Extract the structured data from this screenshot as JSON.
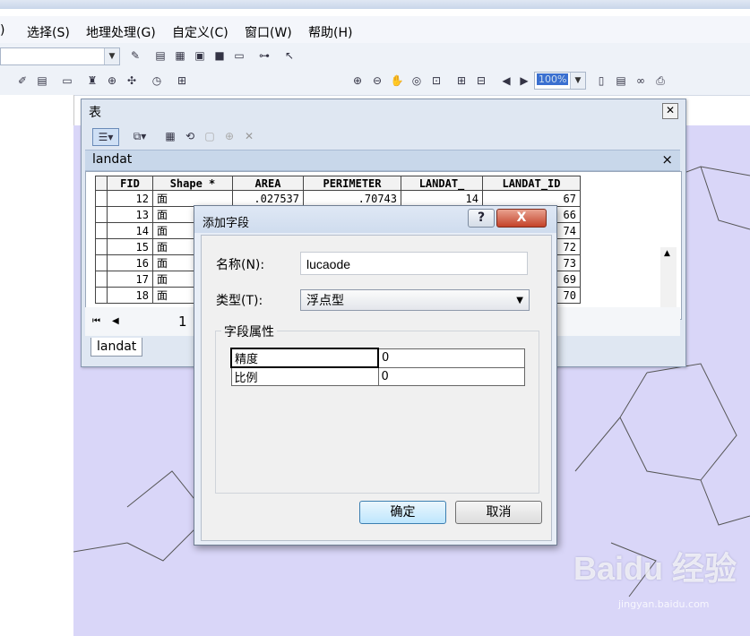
{
  "menu": [
    "选择(S)",
    "地理处理(G)",
    "自定义(C)",
    "窗口(W)",
    "帮助(H)"
  ],
  "toolbar": {
    "zoom_value": "100%"
  },
  "table_window": {
    "title": "表",
    "layer_name": "landat",
    "columns": [
      "FID",
      "Shape *",
      "AREA",
      "PERIMETER",
      "LANDAT_",
      "LANDAT_ID"
    ],
    "rows": [
      [
        "12",
        "面",
        ".027537",
        ".70743",
        "14",
        "67"
      ],
      [
        "13",
        "面",
        "",
        "",
        "",
        "66"
      ],
      [
        "14",
        "面",
        "",
        "",
        "",
        "74"
      ],
      [
        "15",
        "面",
        "",
        "",
        "",
        "72"
      ],
      [
        "16",
        "面",
        "",
        "",
        "",
        "73"
      ],
      [
        "17",
        "面",
        "",
        "",
        "",
        "69"
      ],
      [
        "18",
        "面",
        "",
        "",
        "",
        "70"
      ]
    ],
    "page_number": "1",
    "tab_label": "landat"
  },
  "dialog": {
    "title": "添加字段",
    "help_label": "?",
    "close_label": "X",
    "name_label": "名称(N):",
    "name_value": "lucaode",
    "type_label": "类型(T):",
    "type_value": "浮点型",
    "props_title": "字段属性",
    "props": [
      {
        "name": "精度",
        "value": "0"
      },
      {
        "name": "比例",
        "value": "0"
      }
    ],
    "ok_label": "确定",
    "cancel_label": "取消"
  },
  "watermark": {
    "text": "Baidu 经验",
    "sub": "jingyan.baidu.com"
  }
}
